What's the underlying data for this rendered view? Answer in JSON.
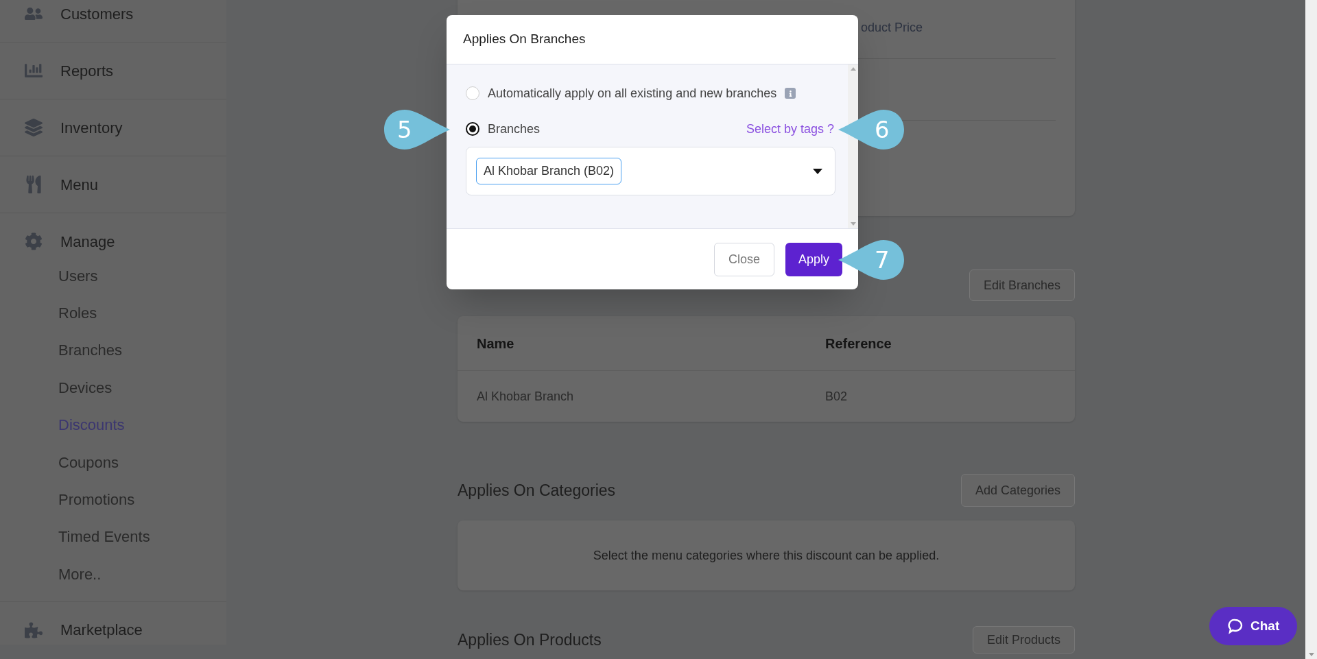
{
  "sidebar": {
    "items": [
      {
        "label": "Customers"
      },
      {
        "label": "Reports"
      },
      {
        "label": "Inventory"
      },
      {
        "label": "Menu"
      },
      {
        "label": "Manage",
        "children": [
          {
            "label": "Users",
            "selected": false
          },
          {
            "label": "Roles",
            "selected": false
          },
          {
            "label": "Branches",
            "selected": false
          },
          {
            "label": "Devices",
            "selected": false
          },
          {
            "label": "Discounts",
            "selected": true
          },
          {
            "label": "Coupons",
            "selected": false
          },
          {
            "label": "Promotions",
            "selected": false
          },
          {
            "label": "Timed Events",
            "selected": false
          },
          {
            "label": "More..",
            "selected": false
          }
        ]
      },
      {
        "label": "Marketplace"
      }
    ]
  },
  "details_card": {
    "visible_text": "oduct Price"
  },
  "branches_section": {
    "button": "Edit Branches",
    "table": {
      "columns": [
        "Name",
        "Reference"
      ],
      "rows": [
        [
          "Al Khobar Branch",
          "B02"
        ]
      ]
    }
  },
  "categories_section": {
    "title": "Applies On Categories",
    "button": "Add Categories",
    "empty_text": "Select the menu categories where this discount can be applied."
  },
  "products_section": {
    "title": "Applies On Products",
    "button": "Edit Products"
  },
  "modal": {
    "title": "Applies On Branches",
    "options": [
      {
        "label": "Automatically apply on all existing and new branches",
        "selected": false,
        "info": true
      },
      {
        "label": "Branches",
        "selected": true,
        "info": false
      }
    ],
    "link": "Select by tags ?",
    "select": {
      "chips": [
        "Al Khobar Branch (B02)"
      ]
    },
    "buttons": [
      {
        "label": "Close",
        "kind": "secondary"
      },
      {
        "label": "Apply",
        "kind": "primary"
      }
    ]
  },
  "callouts": [
    {
      "label": "5"
    },
    {
      "label": "6"
    },
    {
      "label": "7"
    }
  ],
  "chat": {
    "label": "Chat"
  }
}
